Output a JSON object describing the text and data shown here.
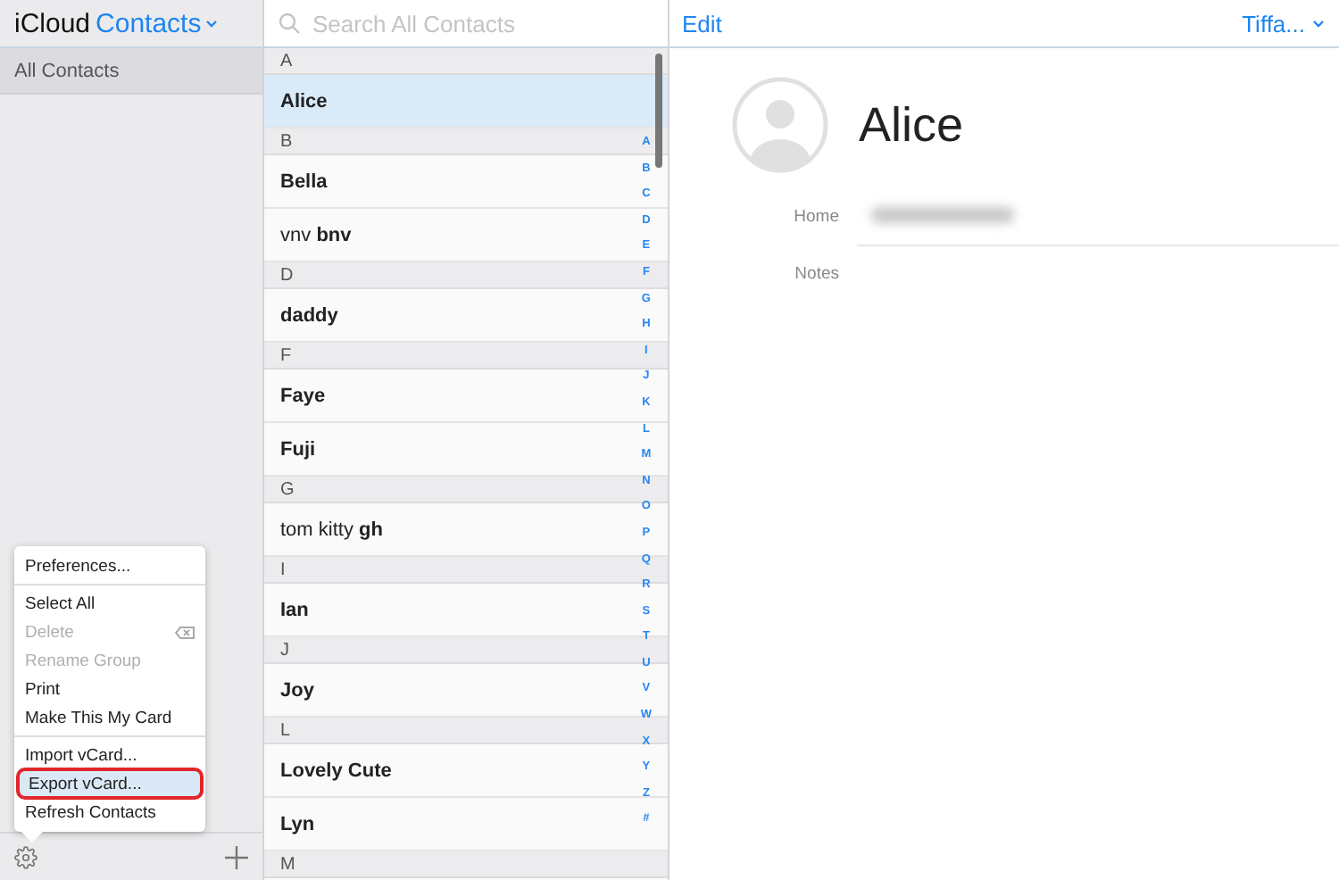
{
  "sidebar": {
    "brand": "iCloud",
    "app": "Contacts",
    "groups": [
      {
        "label": "All Contacts",
        "selected": true
      }
    ]
  },
  "menu": {
    "items": [
      {
        "kind": "item",
        "label": "Preferences...",
        "disabled": false,
        "selected": false
      },
      {
        "kind": "separator"
      },
      {
        "kind": "item",
        "label": "Select All",
        "disabled": false,
        "selected": false
      },
      {
        "kind": "item",
        "label": "Delete",
        "disabled": true,
        "selected": false,
        "shortcut_icon": true
      },
      {
        "kind": "item",
        "label": "Rename Group",
        "disabled": true,
        "selected": false
      },
      {
        "kind": "item",
        "label": "Print",
        "disabled": false,
        "selected": false
      },
      {
        "kind": "item",
        "label": "Make This My Card",
        "disabled": false,
        "selected": false
      },
      {
        "kind": "separator"
      },
      {
        "kind": "item",
        "label": "Import vCard...",
        "disabled": false,
        "selected": false
      },
      {
        "kind": "item",
        "label": "Export vCard...",
        "disabled": false,
        "selected": true
      },
      {
        "kind": "item",
        "label": "Refresh Contacts",
        "disabled": false,
        "selected": false
      }
    ]
  },
  "search": {
    "placeholder": "Search All Contacts"
  },
  "contacts": [
    {
      "kind": "header",
      "label": "A"
    },
    {
      "kind": "contact",
      "name": "Alice",
      "selected": true
    },
    {
      "kind": "header",
      "label": "B"
    },
    {
      "kind": "contact",
      "name": "Bella",
      "selected": false
    },
    {
      "kind": "contact",
      "name": "vnv **bnv**",
      "selected": false
    },
    {
      "kind": "header",
      "label": "D"
    },
    {
      "kind": "contact",
      "name": "daddy",
      "selected": false
    },
    {
      "kind": "header",
      "label": "F"
    },
    {
      "kind": "contact",
      "name": "Faye",
      "selected": false
    },
    {
      "kind": "contact",
      "name": "Fuji",
      "selected": false
    },
    {
      "kind": "header",
      "label": "G"
    },
    {
      "kind": "contact",
      "name": "tom kitty **gh**",
      "selected": false
    },
    {
      "kind": "header",
      "label": "I"
    },
    {
      "kind": "contact",
      "name": "Ian",
      "selected": false
    },
    {
      "kind": "header",
      "label": "J"
    },
    {
      "kind": "contact",
      "name": "Joy",
      "selected": false
    },
    {
      "kind": "header",
      "label": "L"
    },
    {
      "kind": "contact",
      "name": "Lovely Cute",
      "selected": false
    },
    {
      "kind": "contact",
      "name": "Lyn",
      "selected": false
    },
    {
      "kind": "header",
      "label": "M"
    }
  ],
  "index": [
    "A",
    "B",
    "C",
    "D",
    "E",
    "F",
    "G",
    "H",
    "I",
    "J",
    "K",
    "L",
    "M",
    "N",
    "O",
    "P",
    "Q",
    "R",
    "S",
    "T",
    "U",
    "V",
    "W",
    "X",
    "Y",
    "Z",
    "#"
  ],
  "detail": {
    "edit": "Edit",
    "account": "Tiffa...",
    "name": "Alice",
    "fields": [
      {
        "label": "Home",
        "redacted": true
      },
      {
        "label": "Notes",
        "redacted": false
      }
    ]
  }
}
